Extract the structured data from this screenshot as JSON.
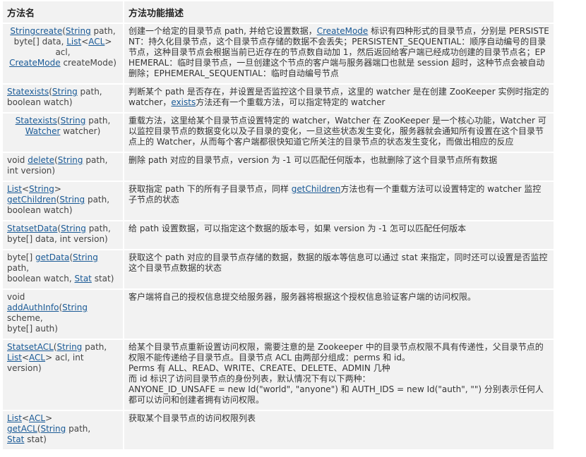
{
  "header": {
    "col1": "方法名",
    "col2": "方法功能描述"
  },
  "rows": [
    {
      "center": true,
      "sig": [
        {
          "t": "Stringcreate",
          "link": true
        },
        {
          "t": "(",
          "link": false
        },
        {
          "t": "String",
          "link": true
        },
        {
          "t": " path,",
          "link": false
        },
        {
          "br": true
        },
        {
          "t": "byte[] data, ",
          "link": false
        },
        {
          "t": "List",
          "link": true
        },
        {
          "t": "<",
          "link": false
        },
        {
          "t": "ACL",
          "link": true
        },
        {
          "t": "> acl,",
          "link": false
        },
        {
          "br": true
        },
        {
          "t": "CreateMode",
          "link": true
        },
        {
          "t": " createMode)",
          "link": false
        }
      ],
      "desc": [
        {
          "t": "创建一个给定的目录节点 path, 并给它设置数据，",
          "link": false
        },
        {
          "t": "CreateMode",
          "link": true
        },
        {
          "t": " 标识有四种形式的目录节点，分别是 PERSISTENT：持久化目录节点，这个目录节点存储的数据不会丢失；PERSISTENT_SEQUENTIAL：顺序自动编号的目录节点，这种目录节点会根据当前已近存在的节点数自动加 1，然后返回给客户端已经成功创建的目录节点名；EPHEMERAL：临时目录节点，一旦创建这个节点的客户端与服务器端口也就是 session 超时，这种节点会被自动删除；EPHEMERAL_SEQUENTIAL：临时自动编号节点",
          "link": false
        }
      ]
    },
    {
      "center": false,
      "sig": [
        {
          "t": "Statexists",
          "link": true
        },
        {
          "t": "(",
          "link": false
        },
        {
          "t": "String",
          "link": true
        },
        {
          "t": " path,",
          "link": false
        },
        {
          "br": true
        },
        {
          "t": "boolean watch)",
          "link": false
        }
      ],
      "desc": [
        {
          "t": "判断某个 path 是否存在，并设置是否监控这个目录节点，这里的 watcher 是在创建 ZooKeeper 实例时指定的 watcher，",
          "link": false
        },
        {
          "t": "exists",
          "link": true
        },
        {
          "t": "方法还有一个重载方法，可以指定特定的 watcher",
          "link": false
        }
      ]
    },
    {
      "center": true,
      "sig": [
        {
          "t": "Statexists",
          "link": true
        },
        {
          "t": "(",
          "link": false
        },
        {
          "t": "String",
          "link": true
        },
        {
          "t": " path,",
          "link": false
        },
        {
          "br": true
        },
        {
          "t": "Watcher",
          "link": true
        },
        {
          "t": " watcher)",
          "link": false
        }
      ],
      "desc": [
        {
          "t": "重载方法，这里给某个目录节点设置特定的 watcher，Watcher 在 ZooKeeper 是一个核心功能，Watcher 可以监控目录节点的数据变化以及子目录的变化，一旦这些状态发生变化，服务器就会通知所有设置在这个目录节点上的 Watcher，从而每个客户端都很快知道它所关注的目录节点的状态发生变化，而做出相应的反应",
          "link": false
        }
      ]
    },
    {
      "center": false,
      "sig": [
        {
          "t": "void ",
          "link": false
        },
        {
          "t": "delete",
          "link": true
        },
        {
          "t": "(",
          "link": false
        },
        {
          "t": "String",
          "link": true
        },
        {
          "t": " path,",
          "link": false
        },
        {
          "br": true
        },
        {
          "t": "int version)",
          "link": false
        }
      ],
      "desc": [
        {
          "t": "删除 path 对应的目录节点，version 为 -1 可以匹配任何版本，也就删除了这个目录节点所有数据",
          "link": false
        }
      ]
    },
    {
      "center": false,
      "sig": [
        {
          "t": "List",
          "link": true
        },
        {
          "t": "<",
          "link": false
        },
        {
          "t": "String",
          "link": true
        },
        {
          "t": ">",
          "link": false
        },
        {
          "br": true
        },
        {
          "t": "getChildren",
          "link": true
        },
        {
          "t": "(",
          "link": false
        },
        {
          "t": "String",
          "link": true
        },
        {
          "t": " path,",
          "link": false
        },
        {
          "br": true
        },
        {
          "t": "boolean watch)",
          "link": false
        }
      ],
      "desc": [
        {
          "t": "获取指定 path 下的所有子目录节点，同样 ",
          "link": false
        },
        {
          "t": "getChildren",
          "link": true
        },
        {
          "t": "方法也有一个重载方法可以设置特定的 watcher 监控子节点的状态",
          "link": false
        }
      ]
    },
    {
      "center": false,
      "sig": [
        {
          "t": "StatsetData",
          "link": true
        },
        {
          "t": "(",
          "link": false
        },
        {
          "t": "String",
          "link": true
        },
        {
          "t": " path,",
          "link": false
        },
        {
          "br": true
        },
        {
          "t": "byte[] data, int version)",
          "link": false
        }
      ],
      "desc": [
        {
          "t": "给 path 设置数据，可以指定这个数据的版本号，如果 version 为 -1 怎可以匹配任何版本",
          "link": false
        }
      ]
    },
    {
      "center": false,
      "sig": [
        {
          "t": "byte[] ",
          "link": false
        },
        {
          "t": "getData",
          "link": true
        },
        {
          "t": "(",
          "link": false
        },
        {
          "t": "String",
          "link": true
        },
        {
          "t": " path,",
          "link": false
        },
        {
          "br": true
        },
        {
          "t": "boolean watch, ",
          "link": false
        },
        {
          "t": "Stat",
          "link": true
        },
        {
          "t": " stat)",
          "link": false
        }
      ],
      "desc": [
        {
          "t": "获取这个 path 对应的目录节点存储的数据，数据的版本等信息可以通过 stat 来指定，同时还可以设置是否监控这个目录节点数据的状态",
          "link": false
        }
      ]
    },
    {
      "center": false,
      "sig": [
        {
          "t": "void",
          "link": false
        },
        {
          "br": true
        },
        {
          "t": "addAuthInfo",
          "link": true
        },
        {
          "t": "(",
          "link": false
        },
        {
          "t": "String",
          "link": true
        },
        {
          "t": " scheme,",
          "link": false
        },
        {
          "br": true
        },
        {
          "t": "byte[] auth)",
          "link": false
        }
      ],
      "desc": [
        {
          "t": "客户端将自己的授权信息提交给服务器，服务器将根据这个授权信息验证客户端的访问权限。",
          "link": false
        }
      ]
    },
    {
      "center": false,
      "sig": [
        {
          "t": "StatsetACL",
          "link": true
        },
        {
          "t": "(",
          "link": false
        },
        {
          "t": "String",
          "link": true
        },
        {
          "t": " path,",
          "link": false
        },
        {
          "br": true
        },
        {
          "t": "List",
          "link": true
        },
        {
          "t": "<",
          "link": false
        },
        {
          "t": "ACL",
          "link": true
        },
        {
          "t": "> acl, int version)",
          "link": false
        }
      ],
      "desc": [
        {
          "t": "给某个目录节点重新设置访问权限，需要注意的是 Zookeeper 中的目录节点权限不具有传递性，父目录节点的权限不能传递给子目录节点。目录节点 ACL 由两部分组成：perms 和 id。",
          "link": false
        },
        {
          "br": true
        },
        {
          "t": "Perms 有 ALL、READ、WRITE、CREATE、DELETE、ADMIN 几种",
          "link": false
        },
        {
          "br": true
        },
        {
          "t": "而 id 标识了访问目录节点的身份列表，默认情况下有以下两种：",
          "link": false
        },
        {
          "br": true
        },
        {
          "t": "ANYONE_ID_UNSAFE = new Id(\"world\", \"anyone\") 和 AUTH_IDS = new Id(\"auth\", \"\") 分别表示任何人都可以访问和创建者拥有访问权限。",
          "link": false
        }
      ]
    },
    {
      "center": false,
      "sig": [
        {
          "t": "List",
          "link": true
        },
        {
          "t": "<",
          "link": false
        },
        {
          "t": "ACL",
          "link": true
        },
        {
          "t": ">",
          "link": false
        },
        {
          "br": true
        },
        {
          "t": "getACL",
          "link": true
        },
        {
          "t": "(",
          "link": false
        },
        {
          "t": "String",
          "link": true
        },
        {
          "t": " path,",
          "link": false
        },
        {
          "br": true
        },
        {
          "t": "Stat",
          "link": true
        },
        {
          "t": " stat)",
          "link": false
        }
      ],
      "desc": [
        {
          "t": "获取某个目录节点的访问权限列表",
          "link": false
        }
      ]
    }
  ]
}
